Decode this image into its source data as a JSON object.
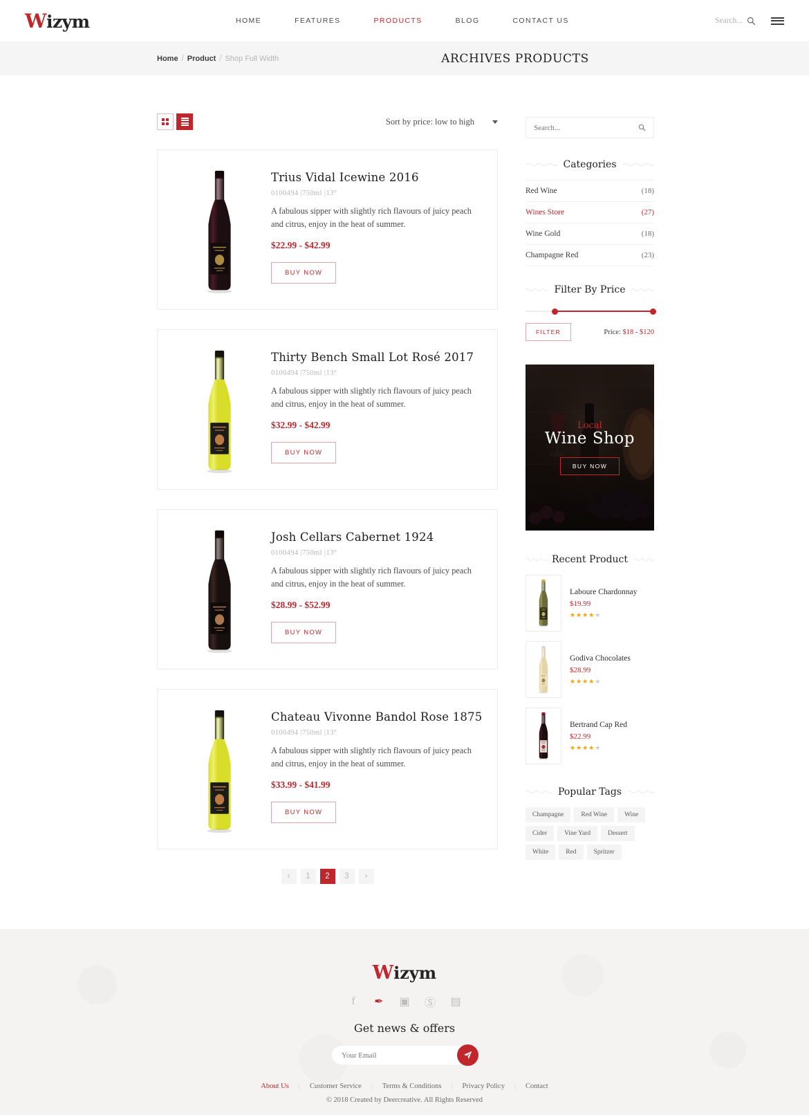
{
  "header": {
    "logo": "Wizym",
    "logo_first": "W",
    "logo_rest": "izym",
    "nav": [
      {
        "label": "HOME",
        "active": false
      },
      {
        "label": "FEATURES",
        "active": false
      },
      {
        "label": "PRODUCTS",
        "active": true
      },
      {
        "label": "BLOG",
        "active": false
      },
      {
        "label": "CONTACT US",
        "active": false
      }
    ],
    "search_placeholder": "Search..."
  },
  "subheader": {
    "breadcrumb": [
      {
        "label": "Home",
        "type": "link"
      },
      {
        "label": "/",
        "type": "sep"
      },
      {
        "label": "Product",
        "type": "link"
      },
      {
        "label": "/",
        "type": "sep"
      },
      {
        "label": "Shop Full Width",
        "type": "current"
      }
    ],
    "title": "ARCHIVES PRODUCTS"
  },
  "toolbar": {
    "grid_view": "grid-view",
    "list_view": "list-view",
    "sort_value": "Sort by price: low to high"
  },
  "products": [
    {
      "title": "Trius Vidal Icewine 2016",
      "meta": "0100494  |750ml  |13°",
      "desc": "A fabulous sipper with slightly rich flavours of juicy peach and citrus, enjoy in the heat of summer.",
      "price": "$22.99 - $42.99",
      "buy_label": "BUY NOW",
      "bottle": "red"
    },
    {
      "title": "Thirty Bench Small Lot Rosé 2017",
      "meta": "0100494  |750ml  |13°",
      "desc": "A fabulous sipper with slightly rich flavours of juicy peach and citrus, enjoy in the heat of summer.",
      "price": "$32.99 - $42.99",
      "buy_label": "BUY NOW",
      "bottle": "white"
    },
    {
      "title": "Josh Cellars Cabernet 1924",
      "meta": "0100494  |750ml  |13°",
      "desc": "A fabulous sipper with slightly rich flavours of juicy peach and citrus, enjoy in the heat of summer.",
      "price": "$28.99 - $52.99",
      "buy_label": "BUY NOW",
      "bottle": "dark"
    },
    {
      "title": "Chateau Vivonne Bandol Rose 1875",
      "meta": "0100494  |750ml  |13°",
      "desc": "A fabulous sipper with slightly rich flavours of juicy peach and citrus, enjoy in the heat of summer.",
      "price": "$33.99 - $41.99",
      "buy_label": "BUY NOW",
      "bottle": "white"
    }
  ],
  "pagination": {
    "prev": "‹",
    "pages": [
      "1",
      "2",
      "3"
    ],
    "current": "2",
    "next": "›"
  },
  "sidebar": {
    "search_placeholder": "Search...",
    "categories_title": "Categories",
    "categories": [
      {
        "label": "Red Wine",
        "count": "(18)",
        "active": false
      },
      {
        "label": "Wines Store",
        "count": "(27)",
        "active": true
      },
      {
        "label": "Wine Gold",
        "count": "(18)",
        "active": false
      },
      {
        "label": "Champagne Red",
        "count": "(23)",
        "active": false
      }
    ],
    "filter_title": "Filter By Price",
    "filter_button": "FILTER",
    "price_label": "Price:",
    "price_range": "$18 - $120",
    "slider_min_pct": 23,
    "slider_max_pct": 100,
    "promo": {
      "eyebrow": "Local",
      "title": "Wine Shop",
      "button": "BUY NOW"
    },
    "recent_title": "Recent Product",
    "recent": [
      {
        "name": "Laboure Chardonnay",
        "price": "$19.99",
        "stars": 4,
        "bottle": "olive"
      },
      {
        "name": "Godiva Chocolates",
        "price": "$28.99",
        "stars": 4,
        "bottle": "pale"
      },
      {
        "name": "Bertrand Cap Red",
        "price": "$22.99",
        "stars": 4,
        "bottle": "darkred"
      }
    ],
    "tags_title": "Popular Tags",
    "tags": [
      "Champagne",
      "Red Wine",
      "Wine",
      "Cider",
      "Vine Yard",
      "Dessert",
      "White",
      "Red",
      "Spritzer"
    ]
  },
  "footer": {
    "logo_first": "W",
    "logo_rest": "izym",
    "socials": [
      {
        "name": "facebook-icon",
        "glyph": "f",
        "active": false
      },
      {
        "name": "twitter-icon",
        "glyph": "✒",
        "active": true
      },
      {
        "name": "instagram-icon",
        "glyph": "▣",
        "active": false
      },
      {
        "name": "skype-icon",
        "glyph": "Ⓢ",
        "active": false
      },
      {
        "name": "camera-icon",
        "glyph": "▤",
        "active": false
      }
    ],
    "newsletter_title": "Get news & offers",
    "email_placeholder": "Your Email",
    "links": [
      {
        "label": "About Us",
        "active": true
      },
      {
        "label": "Customer Service",
        "active": false
      },
      {
        "label": "Terms & Conditions",
        "active": false
      },
      {
        "label": "Privacy Policy",
        "active": false
      },
      {
        "label": "Contact",
        "active": false
      }
    ],
    "copyright": "© 2018 Created by Deercreative. All Rights Reserved"
  },
  "colors": {
    "accent": "#c0272d",
    "text": "#333333",
    "muted": "#b6b6b6",
    "panel": "#f5f5f5"
  }
}
